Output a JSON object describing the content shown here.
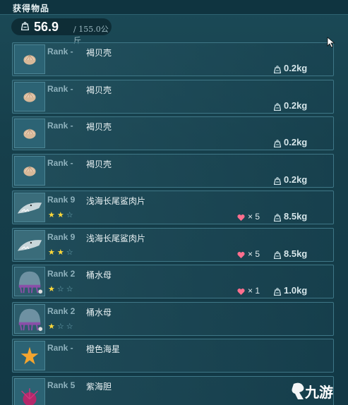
{
  "header": {
    "title": "获得物品"
  },
  "weight": {
    "current": "56.9",
    "max": "/ 155.0公斤",
    "icon": "weight-icon"
  },
  "rows": [
    {
      "rank": "Rank -",
      "name": "褐贝壳",
      "stars": 0,
      "hearts": "",
      "weight": "0.2kg",
      "thumb": "shell"
    },
    {
      "rank": "Rank -",
      "name": "褐贝壳",
      "stars": 0,
      "hearts": "",
      "weight": "0.2kg",
      "thumb": "shell"
    },
    {
      "rank": "Rank -",
      "name": "褐贝壳",
      "stars": 0,
      "hearts": "",
      "weight": "0.2kg",
      "thumb": "shell"
    },
    {
      "rank": "Rank -",
      "name": "褐贝壳",
      "stars": 0,
      "hearts": "",
      "weight": "0.2kg",
      "thumb": "shell"
    },
    {
      "rank": "Rank 9",
      "name": "浅海长尾鲨肉片",
      "stars": 2,
      "hearts": "× 5",
      "weight": "8.5kg",
      "thumb": "shark"
    },
    {
      "rank": "Rank 9",
      "name": "浅海长尾鲨肉片",
      "stars": 2,
      "hearts": "× 5",
      "weight": "8.5kg",
      "thumb": "shark"
    },
    {
      "rank": "Rank 2",
      "name": "桶水母",
      "stars": 1,
      "hearts": "× 1",
      "weight": "1.0kg",
      "thumb": "jelly"
    },
    {
      "rank": "Rank 2",
      "name": "桶水母",
      "stars": 1,
      "hearts": "",
      "weight": "",
      "thumb": "jelly"
    },
    {
      "rank": "Rank -",
      "name": "橙色海星",
      "stars": 0,
      "hearts": "",
      "weight": "",
      "thumb": "starfish"
    },
    {
      "rank": "Rank 5",
      "name": "紫海胆",
      "stars": 0,
      "hearts": "",
      "weight": "",
      "thumb": "urchin"
    }
  ],
  "colors": {
    "star_on": "#ffd93a",
    "heart": "#ff6f8e",
    "accent": "#8fd5e3"
  },
  "watermark": {
    "text": "九游"
  }
}
